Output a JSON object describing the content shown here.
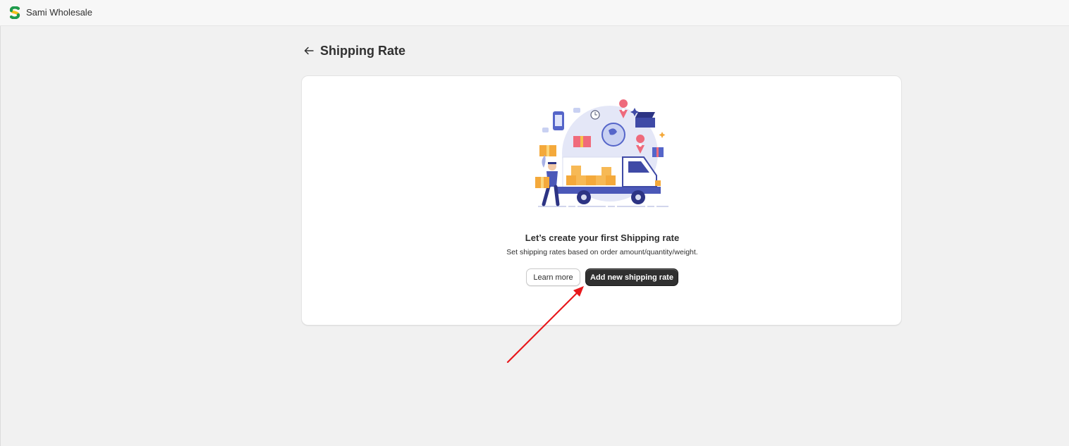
{
  "app": {
    "name": "Sami Wholesale",
    "logo_icon": "app-logo-icon"
  },
  "header": {
    "title": "Shipping Rate",
    "back_icon": "arrow-left-icon"
  },
  "empty_state": {
    "heading": "Let’s create your first Shipping rate",
    "description": "Set shipping rates based on order amount/quantity/weight.",
    "illustration": "delivery-truck-illustration",
    "secondary_button": "Learn more",
    "primary_button": "Add new shipping rate"
  },
  "annotation": {
    "arrow_color": "#e8181c"
  },
  "colors": {
    "primary_button": "#303030",
    "background": "#f1f1f1",
    "card": "#ffffff"
  }
}
